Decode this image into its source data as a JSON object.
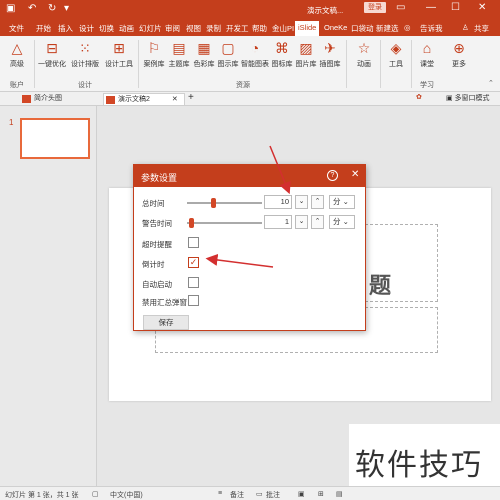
{
  "window": {
    "title": "演示文稿...",
    "login_label": "登录",
    "tell_me": "告诉我",
    "share": "共享"
  },
  "ribbon_tabs": [
    "文件",
    "开始",
    "插入",
    "设计",
    "切换",
    "动画",
    "幻灯片",
    "审阅",
    "视图",
    "录制",
    "开发工",
    "帮助",
    "金山PI",
    "iSlide",
    "OneKe",
    "口袋动",
    "新建选"
  ],
  "ribbon": {
    "buttons": [
      "高级",
      "一键优化",
      "设计排版",
      "设计工具",
      "案例库",
      "主题库",
      "色彩库",
      "图示库",
      "智能图表",
      "图标库",
      "图片库",
      "插图库",
      "动画",
      "工具",
      "课堂",
      "更多"
    ],
    "groups": [
      "账户",
      "设计",
      "资源",
      "学习"
    ]
  },
  "doc_tabs": [
    "简介头图",
    "演示文稿2"
  ],
  "doc_bar_right": "多窗口模式",
  "slides": {
    "number": "1"
  },
  "canvas": {
    "placeholder_title": "题"
  },
  "dialog": {
    "title": "参数设置",
    "help_icon": "?",
    "close_icon": "✕",
    "rows": {
      "total_time": {
        "label": "总时间",
        "value": "10",
        "unit": "分"
      },
      "warn_time": {
        "label": "警告时间",
        "value": "1",
        "unit": "分"
      },
      "overtime": {
        "label": "超时提醒",
        "checked": false
      },
      "countdown": {
        "label": "倒计时",
        "checked": true
      },
      "autostart": {
        "label": "自动启动",
        "checked": false
      },
      "disable_popup": {
        "label": "禁用汇总弹窗",
        "checked": false
      }
    },
    "save_label": "保存",
    "total_slider_level": 0.35,
    "warn_slider_level": 0.05
  },
  "status": {
    "slide_info": "幻灯片 第 1 张，共 1 张",
    "language": "中文(中国)",
    "notes": "备注",
    "comments": "批注"
  },
  "watermark": "软件技巧",
  "colors": {
    "accent": "#c43e1c",
    "dialog_border": "#c43e1c",
    "arrow": "#d32f2f"
  }
}
